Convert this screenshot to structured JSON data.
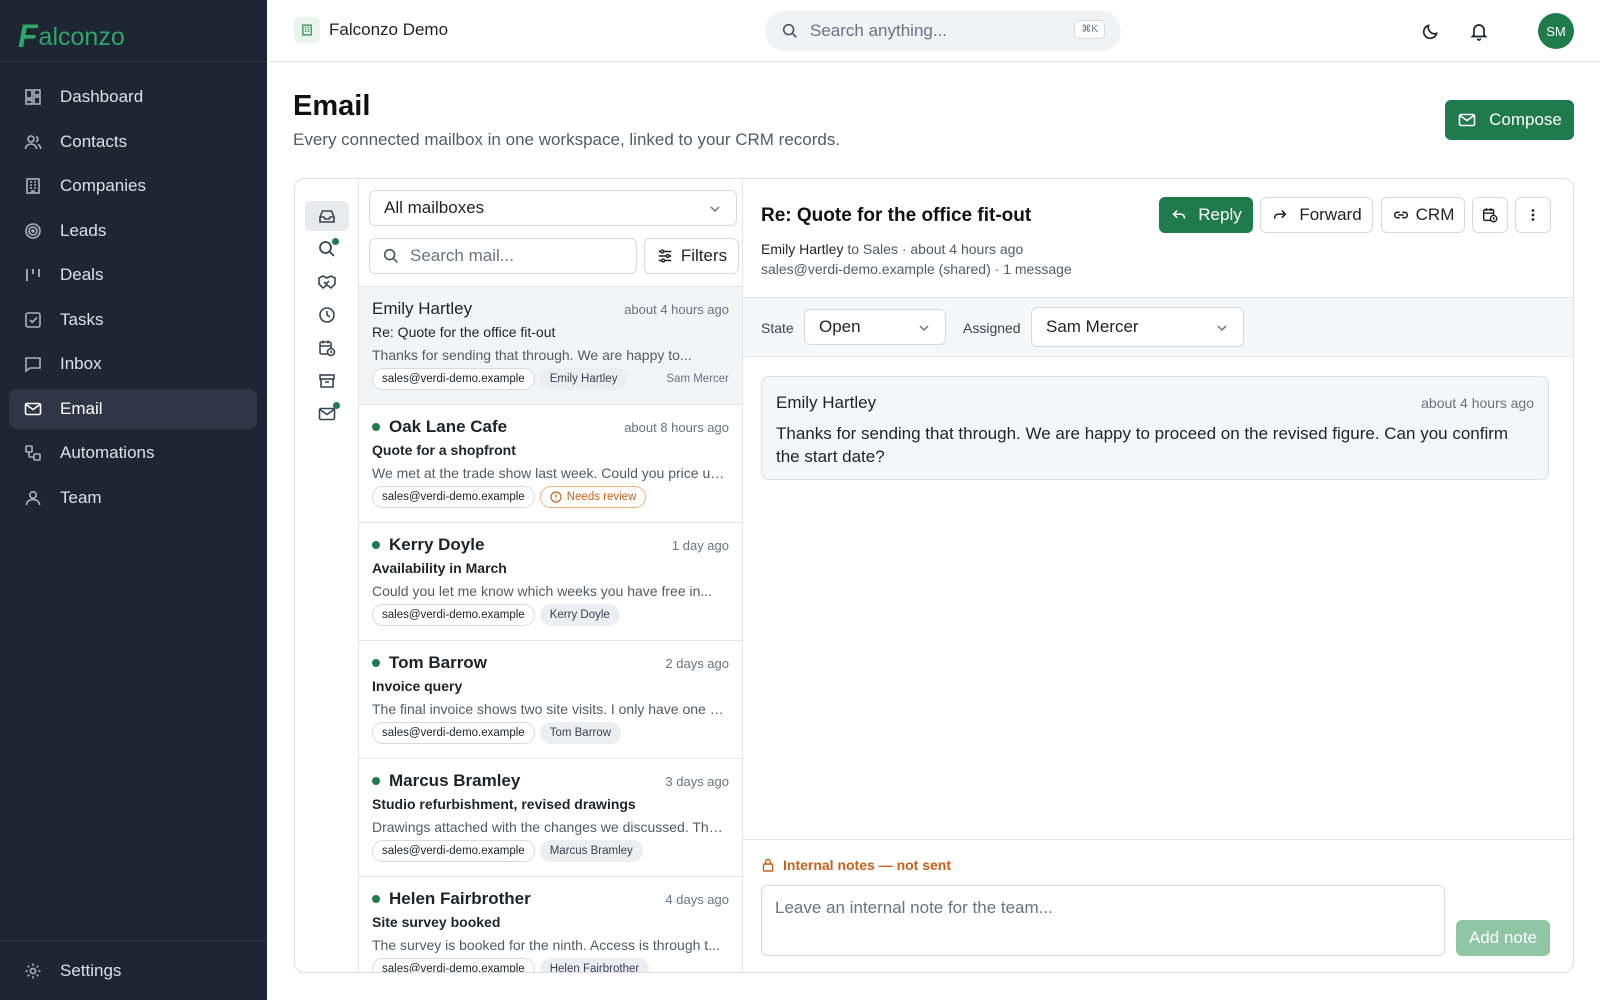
{
  "app": {
    "logo_mark": "F",
    "logo_text": "alconzo",
    "workspace": "Falconzo Demo",
    "avatar_initials": "SM"
  },
  "search": {
    "placeholder": "Search anything...",
    "shortcut": "⌘K"
  },
  "sidebar": {
    "items": [
      {
        "label": "Dashboard",
        "icon": "dashboard-icon"
      },
      {
        "label": "Contacts",
        "icon": "contacts-icon"
      },
      {
        "label": "Companies",
        "icon": "companies-icon"
      },
      {
        "label": "Leads",
        "icon": "leads-icon"
      },
      {
        "label": "Deals",
        "icon": "deals-icon"
      },
      {
        "label": "Tasks",
        "icon": "tasks-icon"
      },
      {
        "label": "Inbox",
        "icon": "inbox-icon"
      },
      {
        "label": "Email",
        "icon": "email-icon",
        "active": true
      },
      {
        "label": "Automations",
        "icon": "automations-icon"
      },
      {
        "label": "Team",
        "icon": "team-icon"
      }
    ],
    "settings_label": "Settings"
  },
  "page": {
    "title": "Email",
    "subtitle": "Every connected mailbox in one workspace, linked to your CRM records.",
    "compose_label": "Compose"
  },
  "list": {
    "mailbox_select": "All mailboxes",
    "search_placeholder": "Search mail...",
    "filters_label": "Filters",
    "threads": [
      {
        "from": "Emily Hartley",
        "time": "about 4 hours ago",
        "subject": "Re: Quote for the office fit-out",
        "preview": "Thanks for sending that through. We are happy to...",
        "mailbox": "sales@verdi-demo.example",
        "tag": "Emily Hartley",
        "assigned": "Sam Mercer",
        "unread": false
      },
      {
        "from": "Oak Lane Cafe",
        "time": "about 8 hours ago",
        "subject": "Quote for a shopfront",
        "preview": "We met at the trade show last week. Could you price up...",
        "mailbox": "sales@verdi-demo.example",
        "tag": "Needs review",
        "assigned": "",
        "unread": true
      },
      {
        "from": "Kerry Doyle",
        "time": "1 day ago",
        "subject": "Availability in March",
        "preview": "Could you let me know which weeks you have free in...",
        "mailbox": "sales@verdi-demo.example",
        "tag": "Kerry Doyle",
        "assigned": "",
        "unread": true
      },
      {
        "from": "Tom Barrow",
        "time": "2 days ago",
        "subject": "Invoice query",
        "preview": "The final invoice shows two site visits. I only have one o...",
        "mailbox": "sales@verdi-demo.example",
        "tag": "Tom Barrow",
        "assigned": "",
        "unread": true
      },
      {
        "from": "Marcus Bramley",
        "time": "3 days ago",
        "subject": "Studio refurbishment, revised drawings",
        "preview": "Drawings attached with the changes we discussed. The...",
        "mailbox": "sales@verdi-demo.example",
        "tag": "Marcus Bramley",
        "assigned": "",
        "unread": true
      },
      {
        "from": "Helen Fairbrother",
        "time": "4 days ago",
        "subject": "Site survey booked",
        "preview": "The survey is booked for the ninth. Access is through t...",
        "mailbox": "sales@verdi-demo.example",
        "tag": "Helen Fairbrother",
        "assigned": "",
        "unread": true
      }
    ]
  },
  "detail": {
    "subject": "Re: Quote for the office fit-out",
    "from": "Emily Hartley",
    "to_text": " to Sales · about 4 hours ago",
    "mailbox_line": "sales@verdi-demo.example (shared) · 1 message",
    "reply_label": "Reply",
    "forward_label": "Forward",
    "crm_label": "CRM",
    "state_label": "State",
    "state_value": "Open",
    "assigned_label": "Assigned",
    "assigned_value": "Sam Mercer",
    "message": {
      "from": "Emily Hartley",
      "time": "about 4 hours ago",
      "body": "Thanks for sending that through. We are happy to proceed on the revised figure. Can you confirm the start date?"
    },
    "notes_label": "Internal notes — not sent",
    "notes_placeholder": "Leave an internal note for the team...",
    "add_note_label": "Add note"
  },
  "colors": {
    "accent": "#1f7a4c",
    "sidebar_bg": "#1f2633",
    "warning": "#c8621a"
  }
}
